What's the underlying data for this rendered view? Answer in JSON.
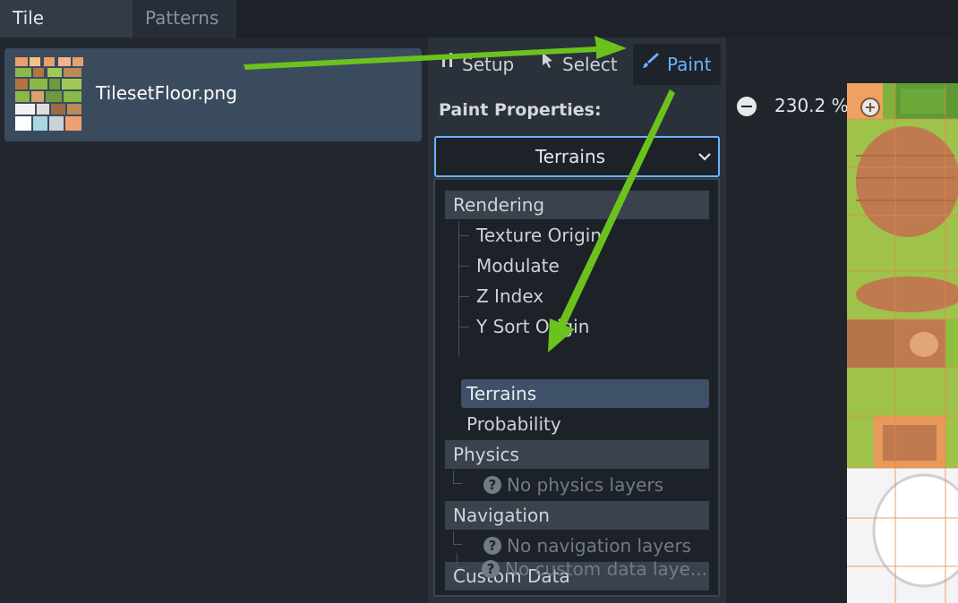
{
  "tabs": {
    "tile_sources": "Tile Sources",
    "patterns": "Patterns"
  },
  "source": {
    "name": "TilesetFloor.png"
  },
  "modes": {
    "setup": "Setup",
    "select": "Select",
    "paint": "Paint"
  },
  "paint_properties": {
    "title": "Paint Properties:",
    "dropdown_value": "Terrains"
  },
  "tree": {
    "rendering": "Rendering",
    "texture_origin": "Texture Origin",
    "modulate": "Modulate",
    "z_index": "Z Index",
    "y_sort_origin": "Y Sort Origin",
    "terrains": "Terrains",
    "probability": "Probability",
    "physics": "Physics",
    "no_physics": "No physics layers",
    "navigation": "Navigation",
    "no_navigation": "No navigation layers",
    "custom_data": "Custom Data",
    "no_custom": "No custom data laye..."
  },
  "zoom": {
    "level": "230.2 %"
  },
  "colors": {
    "accent": "#6ab2ff",
    "selected": "#3e5168",
    "arrow": "#6cc21d"
  }
}
